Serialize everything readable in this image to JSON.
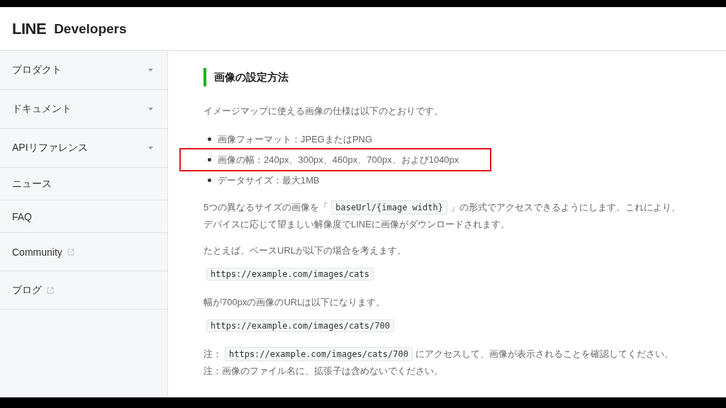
{
  "header": {
    "logo": "LINE",
    "brand": "Developers"
  },
  "sidebar": {
    "items": [
      {
        "label": "プロダクト",
        "kind": "dropdown"
      },
      {
        "label": "ドキュメント",
        "kind": "dropdown"
      },
      {
        "label": "APIリファレンス",
        "kind": "dropdown"
      },
      {
        "label": "ニュース",
        "kind": "plain"
      },
      {
        "label": "FAQ",
        "kind": "plain"
      },
      {
        "label": "Community",
        "kind": "external"
      },
      {
        "label": "ブログ",
        "kind": "external"
      }
    ]
  },
  "content": {
    "heading": "画像の設定方法",
    "intro": "イメージマップに使える画像の仕様は以下のとおりです。",
    "bullets": [
      {
        "text": "画像フォーマット：JPEGまたはPNG",
        "highlighted": false
      },
      {
        "text": "画像の幅：240px、300px、460px、700px、および1040px",
        "highlighted": true
      },
      {
        "text": "データサイズ：最大1MB",
        "highlighted": false
      }
    ],
    "blocks": [
      {
        "kind": "lines",
        "lines": [
          [
            {
              "kind": "text",
              "text": "5つの異なるサイズの画像を「"
            },
            {
              "kind": "code",
              "text": "baseUrl/{image width}"
            },
            {
              "kind": "text",
              "text": "」の形式でアクセスできるようにします。これにより、"
            }
          ],
          [
            {
              "kind": "text",
              "text": "デバイスに応じて望ましい解像度でLINEに画像がダウンロードされます。"
            }
          ]
        ]
      },
      {
        "kind": "lines",
        "lines": [
          [
            {
              "kind": "text",
              "text": "たとえば、ベースURLが以下の場合を考えます。"
            }
          ]
        ]
      },
      {
        "kind": "codeblock",
        "text": "https://example.com/images/cats"
      },
      {
        "kind": "lines",
        "lines": [
          [
            {
              "kind": "text",
              "text": "幅が700pxの画像のURLは以下になります。"
            }
          ]
        ]
      },
      {
        "kind": "codeblock",
        "text": "https://example.com/images/cats/700"
      },
      {
        "kind": "notes",
        "lines": [
          [
            {
              "kind": "text",
              "text": "注："
            },
            {
              "kind": "code",
              "text": "https://example.com/images/cats/700"
            },
            {
              "kind": "text",
              "text": "にアクセスして、画像が表示されることを確認してください。"
            }
          ],
          [
            {
              "kind": "text",
              "text": "注：画像のファイル名に、拡張子は含めないでください。"
            }
          ]
        ]
      }
    ]
  }
}
